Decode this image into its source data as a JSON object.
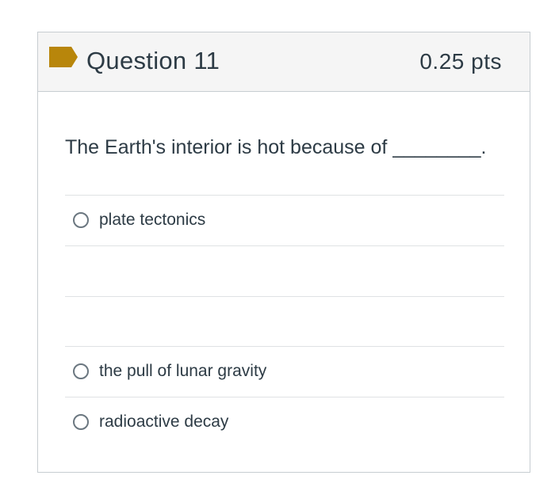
{
  "question": {
    "title": "Question 11",
    "points": "0.25 pts",
    "text": "The Earth's interior is hot because of ________.",
    "flag_icon": "flag-icon",
    "flag_color": "#b8860b"
  },
  "answers": [
    {
      "label": "plate tectonics",
      "selected": false
    },
    {
      "label": "",
      "selected": false
    },
    {
      "label": "",
      "selected": false
    },
    {
      "label": "the pull of lunar gravity",
      "selected": false
    },
    {
      "label": "radioactive decay",
      "selected": false
    }
  ],
  "colors": {
    "header_background": "#f5f5f5",
    "border": "#c7cdd1",
    "text": "#2d3b45"
  }
}
